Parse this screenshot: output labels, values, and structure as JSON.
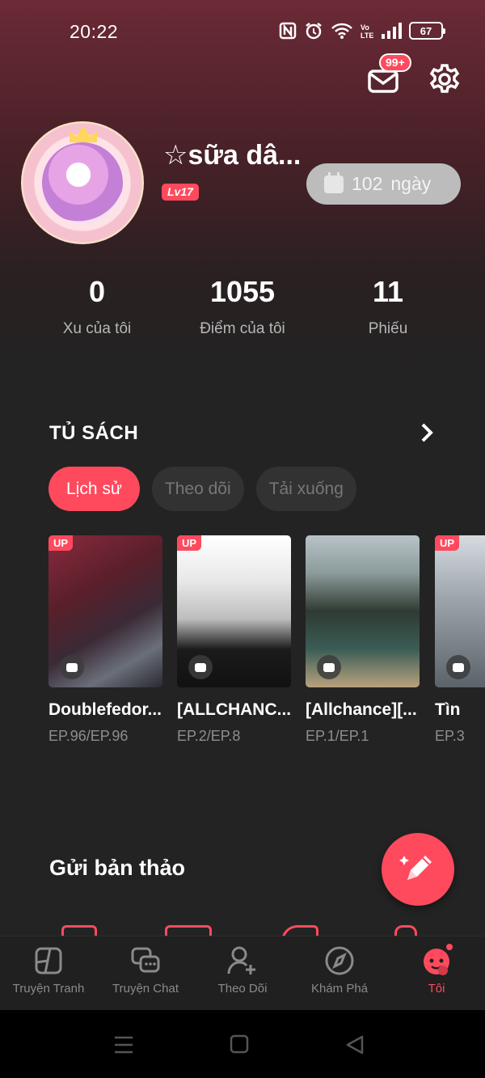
{
  "status_bar": {
    "time": "20:22",
    "battery": "67"
  },
  "header": {
    "mail_badge": "99+"
  },
  "profile": {
    "username": "☆sữa dâ...",
    "level": "Lv17",
    "days_count": "102",
    "days_label": "ngày"
  },
  "stats": [
    {
      "value": "0",
      "label": "Xu của tôi"
    },
    {
      "value": "1055",
      "label": "Điểm của tôi"
    },
    {
      "value": "11",
      "label": "Phiếu"
    }
  ],
  "bookshelf": {
    "title": "TỦ SÁCH",
    "tabs": [
      "Lịch sử",
      "Theo dõi",
      "Tải xuống"
    ],
    "active_tab": "Lịch sử",
    "books": [
      {
        "title": "Doublefedor...",
        "episode": "EP.96/EP.96",
        "tag": "UP"
      },
      {
        "title": "[ALLCHANC...",
        "episode": "EP.2/EP.8",
        "tag": "UP"
      },
      {
        "title": "[Allchance][...",
        "episode": "EP.1/EP.1",
        "tag": ""
      },
      {
        "title": "Tìn",
        "episode": "EP.3",
        "tag": "UP"
      }
    ]
  },
  "submit": {
    "title": "Gửi bản thảo"
  },
  "bottom_nav": [
    {
      "label": "Truyện Tranh",
      "icon": "comic-icon"
    },
    {
      "label": "Truyện Chat",
      "icon": "chat-story-icon"
    },
    {
      "label": "Theo Dõi",
      "icon": "follow-icon"
    },
    {
      "label": "Khám Phá",
      "icon": "compass-icon"
    },
    {
      "label": "Tôi",
      "icon": "profile-icon"
    }
  ],
  "colors": {
    "accent": "#ff4a5e",
    "background": "#232323",
    "header_top": "#6b2a36"
  }
}
